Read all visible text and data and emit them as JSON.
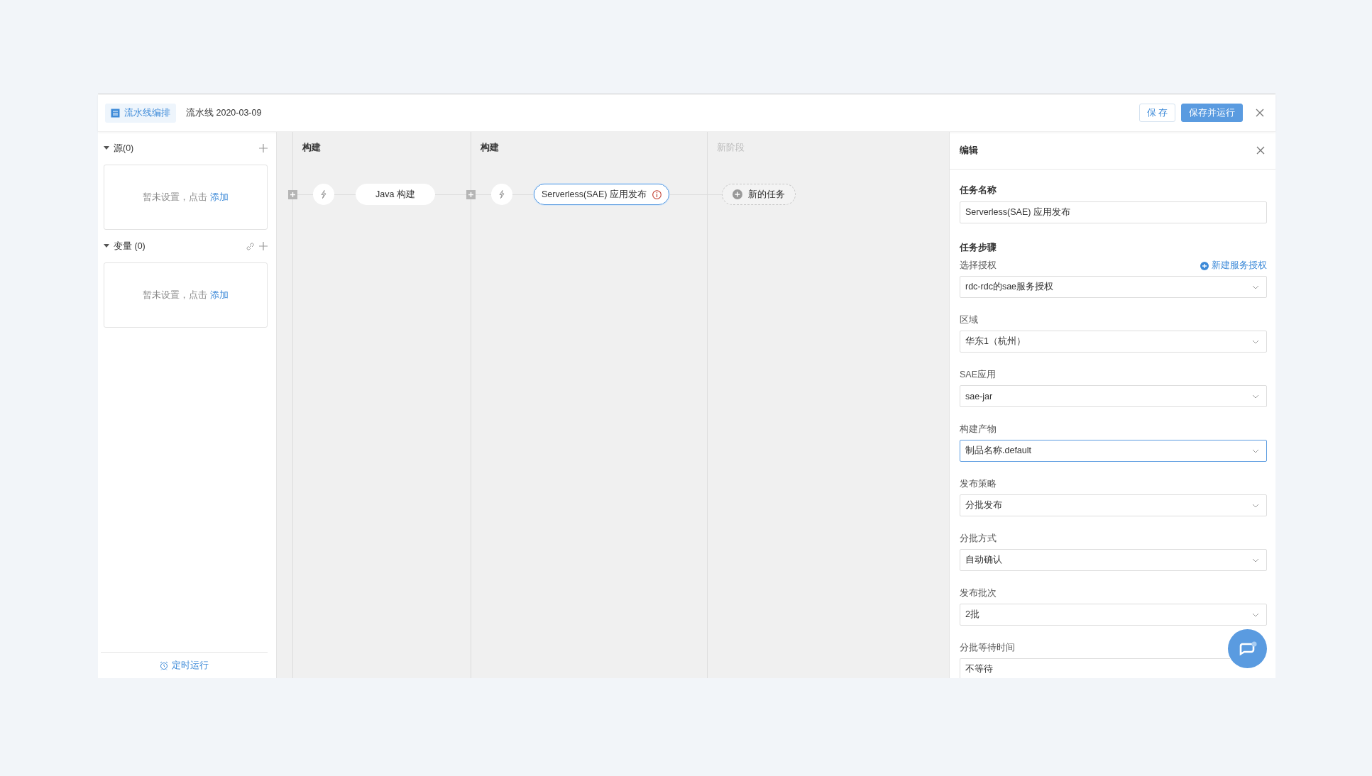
{
  "header": {
    "tab": "流水线编排",
    "title": "流水线 2020-03-09",
    "buttons": [
      {
        "label": "保 存",
        "kind": "default"
      },
      {
        "label": "保存并运行",
        "kind": "primary"
      }
    ]
  },
  "sidebar": {
    "sections": [
      {
        "title": "源(0)",
        "expanded": true,
        "has_link_icon": false,
        "empty_text": "暂未设置，点击",
        "empty_link": "添加"
      },
      {
        "title": "变量 (0)",
        "expanded": true,
        "has_link_icon": true,
        "empty_text": "暂未设置，点击",
        "empty_link": "添加"
      }
    ],
    "footer": "定时运行"
  },
  "stages": [
    {
      "title": "构建",
      "kind": "stage",
      "tasks": [
        {
          "label": "Java 构建",
          "selected": false,
          "warning": false
        }
      ]
    },
    {
      "title": "构建",
      "kind": "stage",
      "tasks": [
        {
          "label": "Serverless(SAE) 应用发布",
          "selected": true,
          "warning": true
        }
      ]
    },
    {
      "title": "新阶段",
      "kind": "new",
      "tasks": [
        {
          "label": "新的任务"
        }
      ]
    }
  ],
  "editor": {
    "title": "编辑",
    "name_label": "任务名称",
    "name_value": "Serverless(SAE) 应用发布",
    "steps_title": "任务步骤",
    "fields": [
      {
        "label": "选择授权",
        "value": "rdc-rdc的sae服务授权",
        "kind": "select",
        "focused": false,
        "action": "新建服务授权"
      },
      {
        "label": "区域",
        "value": "华东1（杭州）",
        "kind": "select",
        "focused": false
      },
      {
        "label": "SAE应用",
        "value": "sae-jar",
        "kind": "select",
        "focused": false
      },
      {
        "label": "构建产物",
        "value": "制品名称.default",
        "kind": "select",
        "focused": true
      },
      {
        "label": "发布策略",
        "value": "分批发布",
        "kind": "select",
        "focused": false
      },
      {
        "label": "分批方式",
        "value": "自动确认",
        "kind": "select",
        "focused": false
      },
      {
        "label": "发布批次",
        "value": "2批",
        "kind": "select",
        "focused": false
      },
      {
        "label": "分批等待时间",
        "value": "不等待",
        "kind": "text",
        "focused": false
      }
    ]
  }
}
